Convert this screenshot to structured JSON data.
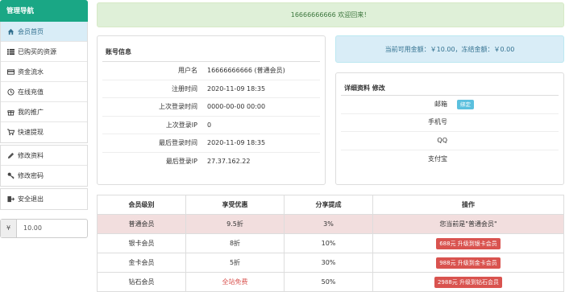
{
  "sidebar": {
    "header": "管理导航",
    "groups": [
      [
        {
          "label": "会员首页",
          "icon": "home-icon",
          "active": true
        },
        {
          "label": "已购买的资源",
          "icon": "list-icon"
        },
        {
          "label": "资金流水",
          "icon": "card-icon"
        },
        {
          "label": "在线充值",
          "icon": "clock-icon"
        },
        {
          "label": "我的推广",
          "icon": "gift-icon"
        },
        {
          "label": "快速提现",
          "icon": "cart-icon"
        }
      ],
      [
        {
          "label": "修改资料",
          "icon": "pencil-icon"
        },
        {
          "label": "修改密码",
          "icon": "key-icon"
        }
      ],
      [
        {
          "label": "安全退出",
          "icon": "logout-icon"
        }
      ]
    ],
    "balance_prefix": "¥",
    "balance_value": "10.00"
  },
  "welcome": "16666666666   欢迎回来！",
  "account": {
    "title": "账号信息",
    "rows": [
      {
        "label": "用户名",
        "value": "16666666666 (普通会员)"
      },
      {
        "label": "注册时间",
        "value": "2020-11-09 18:35"
      },
      {
        "label": "上次登录时间",
        "value": "0000-00-00 00:00"
      },
      {
        "label": "上次登录IP",
        "value": "0"
      },
      {
        "label": "最后登录时间",
        "value": "2020-11-09 18:35"
      },
      {
        "label": "最后登录IP",
        "value": "27.37.162.22"
      }
    ]
  },
  "funds": "当前可用金额：￥10.00，冻结金额：￥0.00",
  "details": {
    "title": "详细资料 修改",
    "rows": [
      {
        "label": "邮箱",
        "badge": "绑定"
      },
      {
        "label": "手机号"
      },
      {
        "label": "QQ"
      },
      {
        "label": "支付宝"
      }
    ]
  },
  "membership": {
    "headers": [
      "会员级别",
      "享受优惠",
      "分享提成",
      "操作"
    ],
    "rows": [
      {
        "level": "普通会员",
        "discount": "9.5折",
        "share": "3%",
        "action": "您当前是\"普通会员\"",
        "current": true
      },
      {
        "level": "银卡会员",
        "discount": "8折",
        "share": "10%",
        "button": "688元 升级到银卡会员"
      },
      {
        "level": "金卡会员",
        "discount": "5折",
        "share": "30%",
        "button": "988元 升级到金卡会员"
      },
      {
        "level": "钻石会员",
        "discount": "全站免费",
        "discount_red": true,
        "share": "50%",
        "button": "2988元 升级到钻石会员"
      }
    ]
  },
  "colors": {
    "nav_header": "#1aa785",
    "active_item": "#d9edf7",
    "success_bg": "#dff0d8",
    "info_bg": "#d9edf7",
    "danger": "#d9534f",
    "current_row": "#f2dede"
  }
}
